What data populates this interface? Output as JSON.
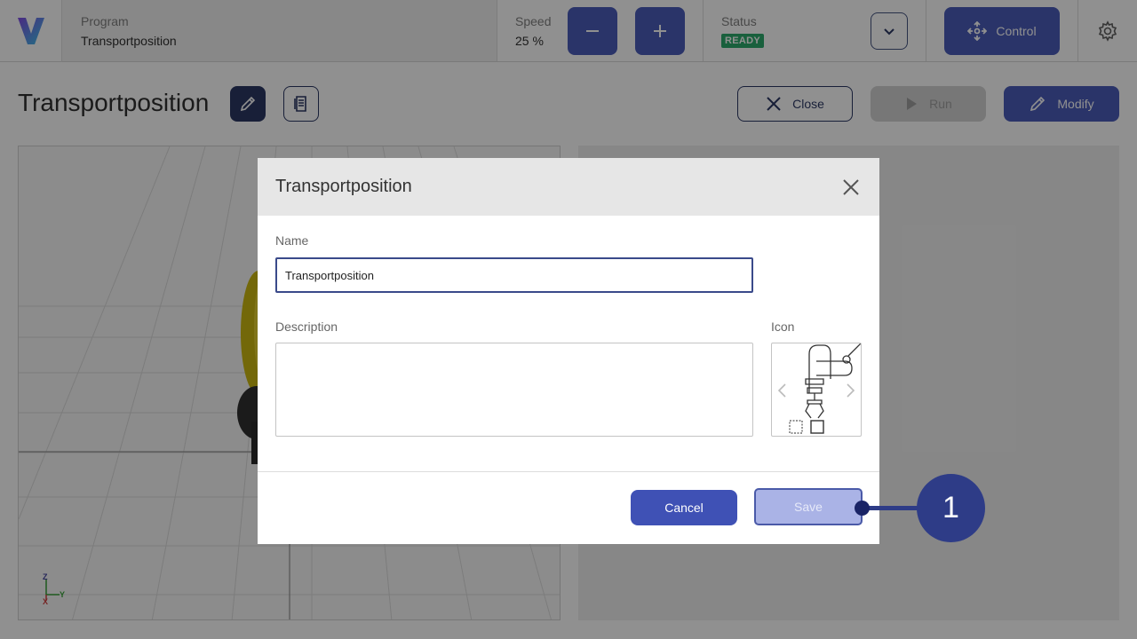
{
  "topbar": {
    "logo_icon": "v-logo-icon",
    "program_label": "Program",
    "program_value": "Transportposition",
    "speed_label": "Speed",
    "speed_value": "25 %",
    "speed_decrease_icon": "minus-icon",
    "speed_increase_icon": "plus-icon",
    "status_label": "Status",
    "status_value": "READY",
    "status_color": "#1fa463",
    "status_dropdown_icon": "chevron-down-icon",
    "control_label": "Control",
    "control_icon": "move-arrows-icon",
    "settings_icon": "gear-icon"
  },
  "page": {
    "title": "Transportposition",
    "edit_icon": "pencil-icon",
    "doc_icon": "document-icon",
    "close_label": "Close",
    "run_label": "Run",
    "modify_label": "Modify"
  },
  "viewport": {
    "axis_labels": [
      "Z",
      "Y",
      "X"
    ]
  },
  "dialog": {
    "title": "Transportposition",
    "name_label": "Name",
    "name_value": "Transportposition",
    "description_label": "Description",
    "description_value": "",
    "icon_label": "Icon",
    "icon_preview": "robot-gripper-icon",
    "cancel_label": "Cancel",
    "save_label": "Save"
  },
  "callout": {
    "number": "1"
  },
  "colors": {
    "accent": "#3f51b5",
    "dark_navy": "#1e2a5a",
    "callout": "#2e3c87"
  }
}
